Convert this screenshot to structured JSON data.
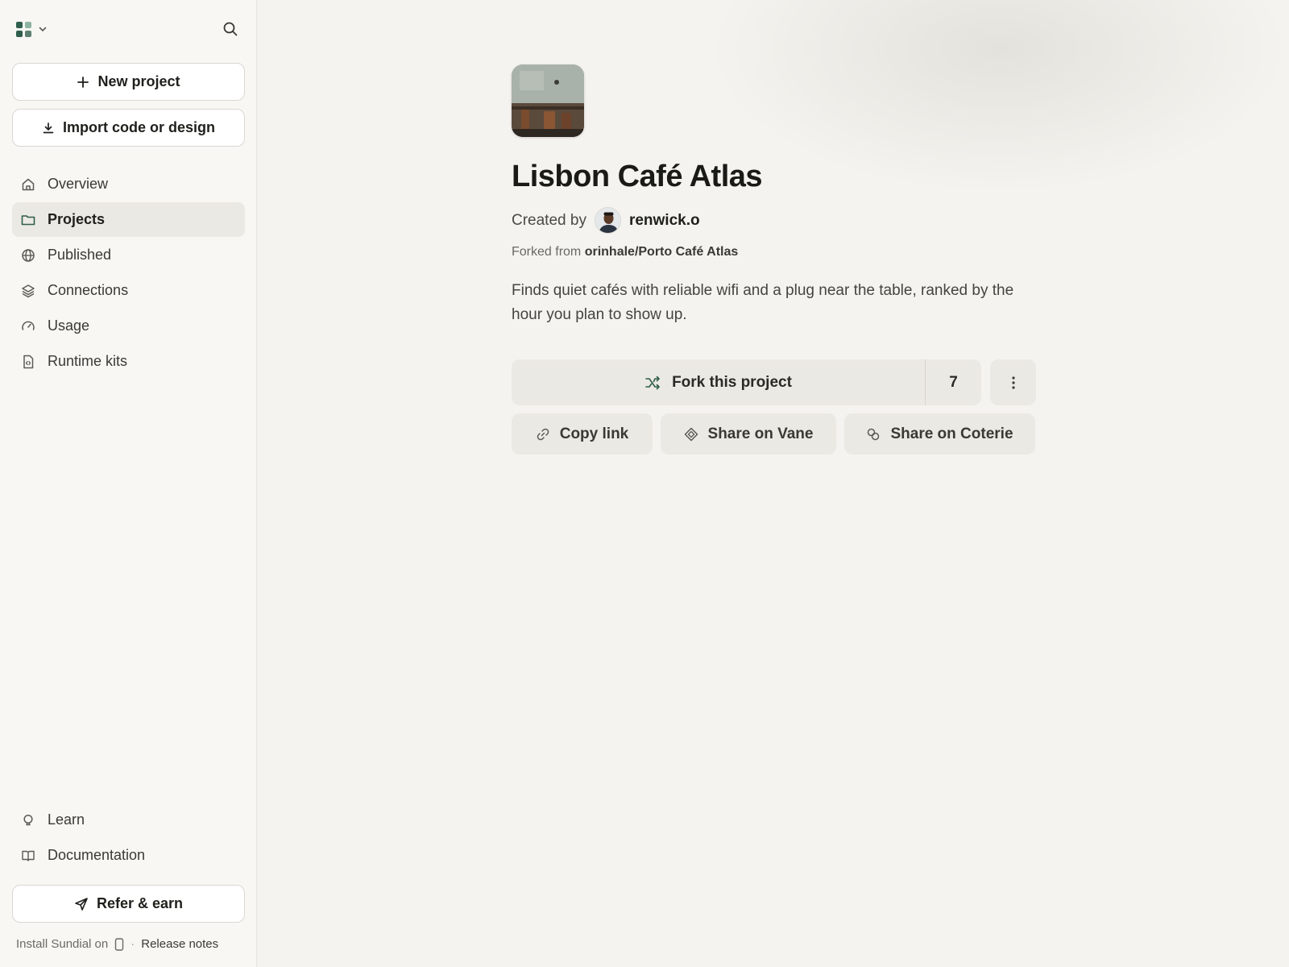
{
  "sidebar": {
    "new_project_label": "New project",
    "import_label": "Import code or design",
    "nav": [
      {
        "label": "Overview",
        "icon": "home-icon",
        "active": false
      },
      {
        "label": "Projects",
        "icon": "folder-icon",
        "active": true
      },
      {
        "label": "Published",
        "icon": "globe-icon",
        "active": false
      },
      {
        "label": "Connections",
        "icon": "layers-icon",
        "active": false
      },
      {
        "label": "Usage",
        "icon": "gauge-icon",
        "active": false
      },
      {
        "label": "Runtime kits",
        "icon": "code-file-icon",
        "active": false
      }
    ],
    "bottom_nav": [
      {
        "label": "Learn",
        "icon": "lightbulb-icon"
      },
      {
        "label": "Documentation",
        "icon": "book-icon"
      }
    ],
    "refer_label": "Refer & earn",
    "footer": {
      "install_text": "Install Sundial on",
      "separator": "·",
      "release_notes": "Release notes"
    }
  },
  "project": {
    "title": "Lisbon Café Atlas",
    "created_by_label": "Created by",
    "author": "renwick.o",
    "forked_from_label": "Forked from",
    "forked_from": "orinhale/Porto Café Atlas",
    "description": "Finds quiet cafés with reliable wifi and a plug near the table, ranked by the hour you plan to show up."
  },
  "actions": {
    "fork_label": "Fork this project",
    "fork_count": "7",
    "copy_link": "Copy link",
    "share_vane": "Share on Vane",
    "share_coterie": "Share on Coterie"
  },
  "colors": {
    "accent": "#2f5e4c",
    "background": "#f4f3ef",
    "sidebar_bg": "#f8f7f3",
    "button_bg": "#ebe9e3"
  }
}
